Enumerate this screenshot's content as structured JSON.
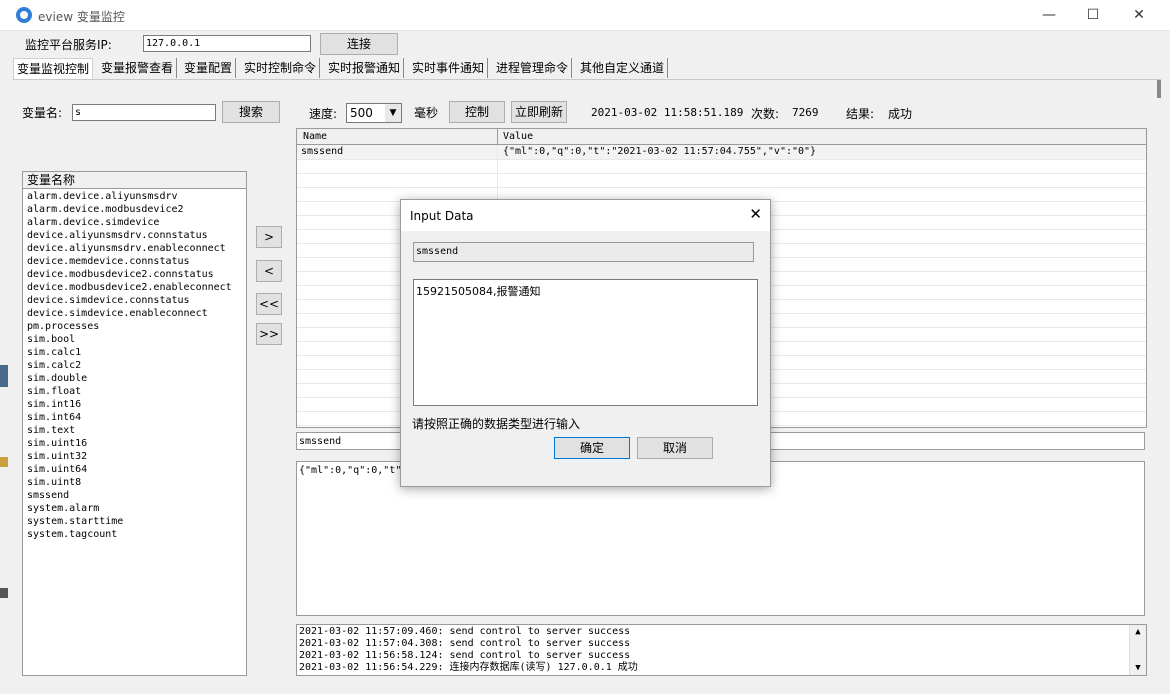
{
  "window": {
    "title": "eview 变量监控",
    "minimize": "—",
    "maximize": "☐",
    "close": "✕"
  },
  "toolbar": {
    "server_label": "监控平台服务IP:",
    "server_ip": "127.0.0.1",
    "connect": "连接"
  },
  "tabs": [
    "变量监视控制",
    "变量报警查看",
    "变量配置",
    "实时控制命令",
    "实时报警通知",
    "实时事件通知",
    "进程管理命令",
    "其他自定义通道"
  ],
  "search": {
    "label": "变量名:",
    "value": "s",
    "button": "搜索"
  },
  "status": {
    "speed_label": "速度:",
    "speed_value": "500",
    "unit": "毫秒",
    "control": "控制",
    "refresh": "立即刷新",
    "timestamp": "2021-03-02 11:58:51.189",
    "count_label": "次数:",
    "count": "7269",
    "result_label": "结果:",
    "result": "成功"
  },
  "var_list": {
    "header": "变量名称",
    "items": [
      "alarm.device.aliyunsmsdrv",
      "alarm.device.modbusdevice2",
      "alarm.device.simdevice",
      "device.aliyunsmsdrv.connstatus",
      "device.aliyunsmsdrv.enableconnect",
      "device.memdevice.connstatus",
      "device.modbusdevice2.connstatus",
      "device.modbusdevice2.enableconnect",
      "device.simdevice.connstatus",
      "device.simdevice.enableconnect",
      "pm.processes",
      "sim.bool",
      "sim.calc1",
      "sim.calc2",
      "sim.double",
      "sim.float",
      "sim.int16",
      "sim.int64",
      "sim.text",
      "sim.uint16",
      "sim.uint32",
      "sim.uint64",
      "sim.uint8",
      "smssend",
      "system.alarm",
      "system.starttime",
      "system.tagcount"
    ]
  },
  "move_buttons": {
    "add": ">",
    "remove": "<",
    "remove_all": "<<",
    "add_all": ">>"
  },
  "watch_table": {
    "columns": [
      "Name",
      "Value"
    ],
    "rows": [
      {
        "name": "smssend",
        "value": "{\"ml\":0,\"q\":0,\"t\":\"2021-03-02 11:57:04.755\",\"v\":\"0\"}"
      }
    ]
  },
  "selected_name": "smssend",
  "detail_text": "{\"ml\":0,\"q\":0,\"t\"",
  "log": [
    "2021-03-02 11:57:09.460: send control to server success",
    "2021-03-02 11:57:04.308: send control to server success",
    "2021-03-02 11:56:58.124: send control to server success",
    "2021-03-02 11:56:54.229: 连接内存数据库(读写) 127.0.0.1 成功"
  ],
  "dialog": {
    "title": "Input Data",
    "close": "✕",
    "name": "smssend",
    "value": "15921505084,报警通知",
    "hint": "请按照正确的数据类型进行输入",
    "ok": "确定",
    "cancel": "取消"
  },
  "colors": {
    "accent": "#0078d7",
    "window_bg": "#f0f0f0",
    "border": "#adadad"
  }
}
